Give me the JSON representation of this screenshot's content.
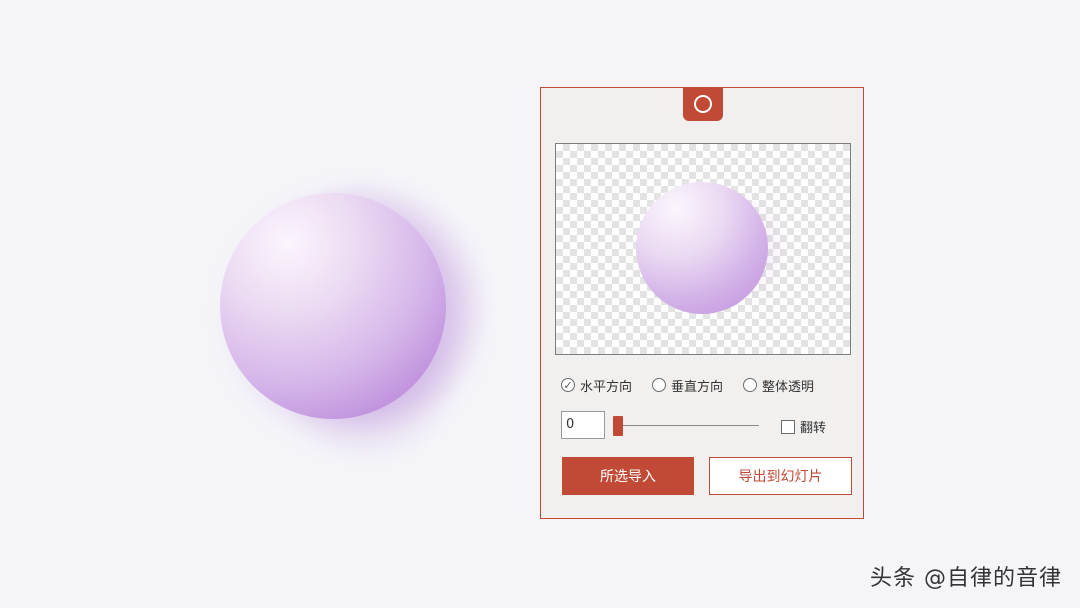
{
  "panel": {
    "handle_icon": "circle-icon",
    "options": [
      {
        "label": "水平方向",
        "selected": true
      },
      {
        "label": "垂直方向",
        "selected": false
      },
      {
        "label": "整体透明",
        "selected": false
      }
    ],
    "slider_value": "0",
    "flip_label": "翻转",
    "flip_checked": false,
    "import_button": "所选导入",
    "export_button": "导出到幻灯片"
  },
  "watermark": "头条 @自律的音律",
  "colors": {
    "accent": "#c04a36",
    "background": "#f5f5f9",
    "panel": "#f2f0ef",
    "orb": "#c194de"
  }
}
